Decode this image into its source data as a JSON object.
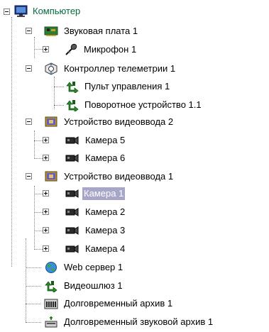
{
  "tree": {
    "root": {
      "label": "Компьютер",
      "icon": "monitor-icon"
    },
    "sound_card": {
      "label": "Звуковая плата 1",
      "icon": "sound-card-icon"
    },
    "microphone": {
      "label": "Микрофон 1",
      "icon": "microphone-icon"
    },
    "telemetry": {
      "label": "Контроллер телеметрии 1",
      "icon": "telemetry-controller-icon"
    },
    "control_panel": {
      "label": "Пульт управления 1",
      "icon": "ptz-arrows-icon"
    },
    "rotary_device": {
      "label": "Поворотное устройство 1.1",
      "icon": "ptz-arrows-icon"
    },
    "video_input_2": {
      "label": "Устройство видеоввода 2",
      "icon": "video-card-icon"
    },
    "camera_5": {
      "label": "Камера 5",
      "icon": "camera-icon"
    },
    "camera_6": {
      "label": "Камера 6",
      "icon": "camera-icon"
    },
    "video_input_1": {
      "label": "Устройство видеоввода 1",
      "icon": "video-card-icon"
    },
    "camera_1": {
      "label": "Камера 1",
      "icon": "camera-icon",
      "selected": true
    },
    "camera_2": {
      "label": "Камера 2",
      "icon": "camera-icon"
    },
    "camera_3": {
      "label": "Камера 3",
      "icon": "camera-icon"
    },
    "camera_4": {
      "label": "Камера 4",
      "icon": "camera-icon"
    },
    "web_server": {
      "label": "Web сервер 1",
      "icon": "globe-icon"
    },
    "video_gateway": {
      "label": "Видеошлюз 1",
      "icon": "ptz-arrows-icon"
    },
    "long_term_archive": {
      "label": "Долговременный архив 1",
      "icon": "archive-icon"
    },
    "long_term_audio_archive": {
      "label": "Долговременный звуковой архив 1",
      "icon": "audio-archive-icon"
    }
  },
  "colors": {
    "root_text": "#006a3b",
    "selection_bg": "#a8a6c8",
    "selection_text": "#ffffff",
    "tree_lines": "#808080"
  }
}
